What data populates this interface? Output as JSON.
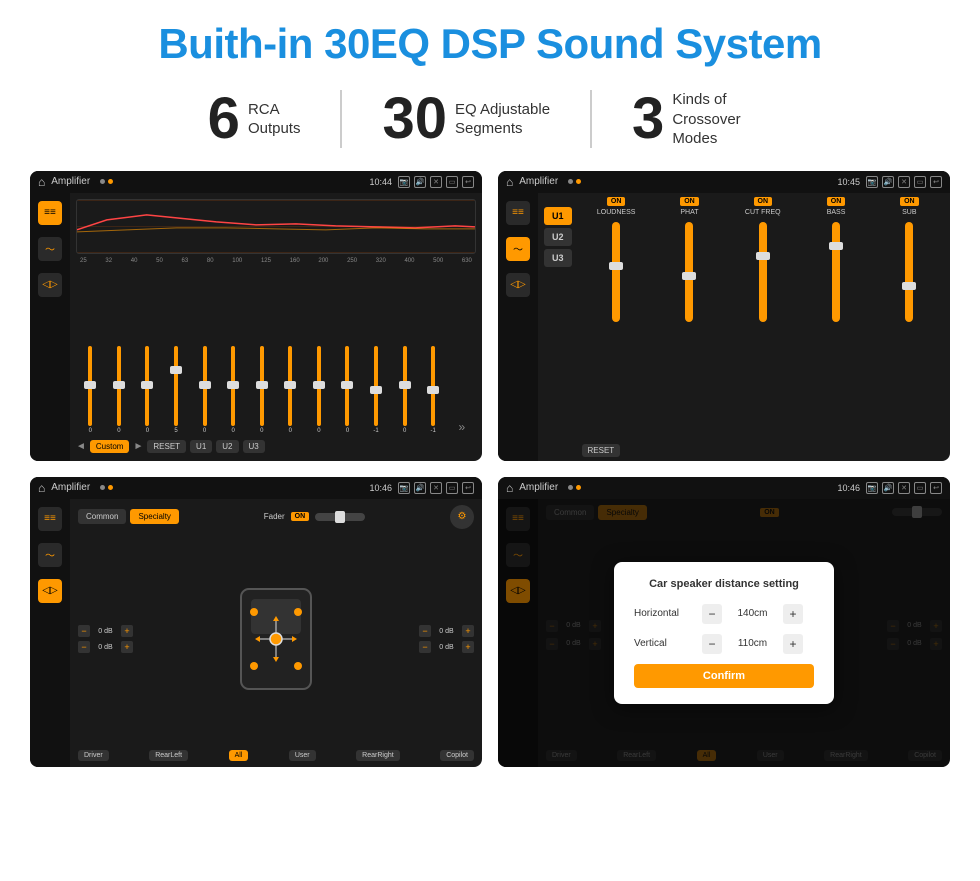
{
  "page": {
    "title": "Buith-in 30EQ DSP Sound System",
    "stats": [
      {
        "number": "6",
        "line1": "RCA",
        "line2": "Outputs"
      },
      {
        "number": "30",
        "line1": "EQ Adjustable",
        "line2": "Segments"
      },
      {
        "number": "3",
        "line1": "Kinds of",
        "line2": "Crossover Modes"
      }
    ]
  },
  "screens": {
    "screen1": {
      "title": "Amplifier",
      "time": "10:44",
      "eq_freqs": [
        "25",
        "32",
        "40",
        "50",
        "63",
        "80",
        "100",
        "125",
        "160",
        "200",
        "250",
        "320",
        "400",
        "500",
        "630"
      ],
      "eq_vals": [
        "0",
        "0",
        "0",
        "5",
        "0",
        "0",
        "0",
        "0",
        "0",
        "0",
        "-1",
        "0",
        "-1"
      ],
      "controls": [
        "Custom",
        "RESET",
        "U1",
        "U2",
        "U3"
      ]
    },
    "screen2": {
      "title": "Amplifier",
      "time": "10:45",
      "u_buttons": [
        "U1",
        "U2",
        "U3"
      ],
      "channels": [
        "LOUDNESS",
        "PHAT",
        "CUT FREQ",
        "BASS",
        "SUB"
      ],
      "reset": "RESET"
    },
    "screen3": {
      "title": "Amplifier",
      "time": "10:46",
      "tabs": [
        "Common",
        "Specialty"
      ],
      "fader_label": "Fader",
      "fader_on": "ON",
      "vol_labels": [
        "0 dB",
        "0 dB",
        "0 dB",
        "0 dB"
      ],
      "bottom_buttons": [
        "Driver",
        "RearLeft",
        "All",
        "User",
        "RearRight",
        "Copilot"
      ]
    },
    "screen4": {
      "title": "Amplifier",
      "time": "10:46",
      "tabs": [
        "Common",
        "Specialty"
      ],
      "dialog": {
        "title": "Car speaker distance setting",
        "horizontal_label": "Horizontal",
        "horizontal_val": "140cm",
        "vertical_label": "Vertical",
        "vertical_val": "110cm",
        "confirm_label": "Confirm"
      }
    }
  }
}
